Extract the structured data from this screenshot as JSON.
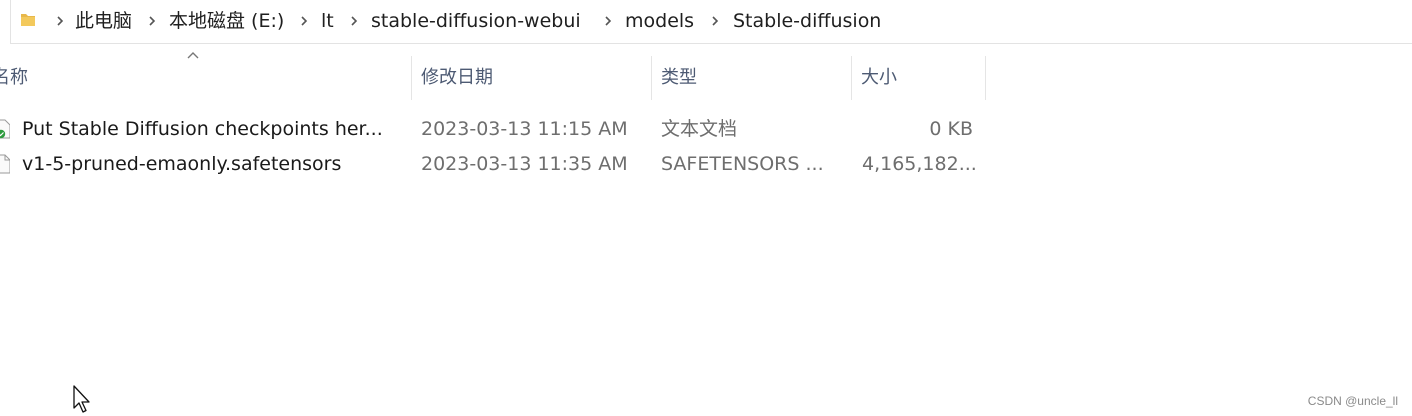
{
  "address_bar": {
    "crumbs": [
      "此电脑",
      "本地磁盘 (E:)",
      "lt",
      "stable-diffusion-webui",
      "models",
      "Stable-diffusion"
    ]
  },
  "columns": {
    "name": "名称",
    "date": "修改日期",
    "type": "类型",
    "size": "大小"
  },
  "files": [
    {
      "name": "Put Stable Diffusion checkpoints her...",
      "date": "2023-03-13 11:15 AM",
      "type": "文本文档",
      "size": "0 KB",
      "icon": "text-file-icon"
    },
    {
      "name": "v1-5-pruned-emaonly.safetensors",
      "date": "2023-03-13 11:35 AM",
      "type": "SAFETENSORS ...",
      "size": "4,165,182...",
      "icon": "generic-file-icon"
    }
  ],
  "watermark": "CSDN @uncle_ll",
  "colors": {
    "folder": "#e8b84a",
    "header_text": "#4d5a73",
    "muted_text": "#6e6e6e"
  }
}
